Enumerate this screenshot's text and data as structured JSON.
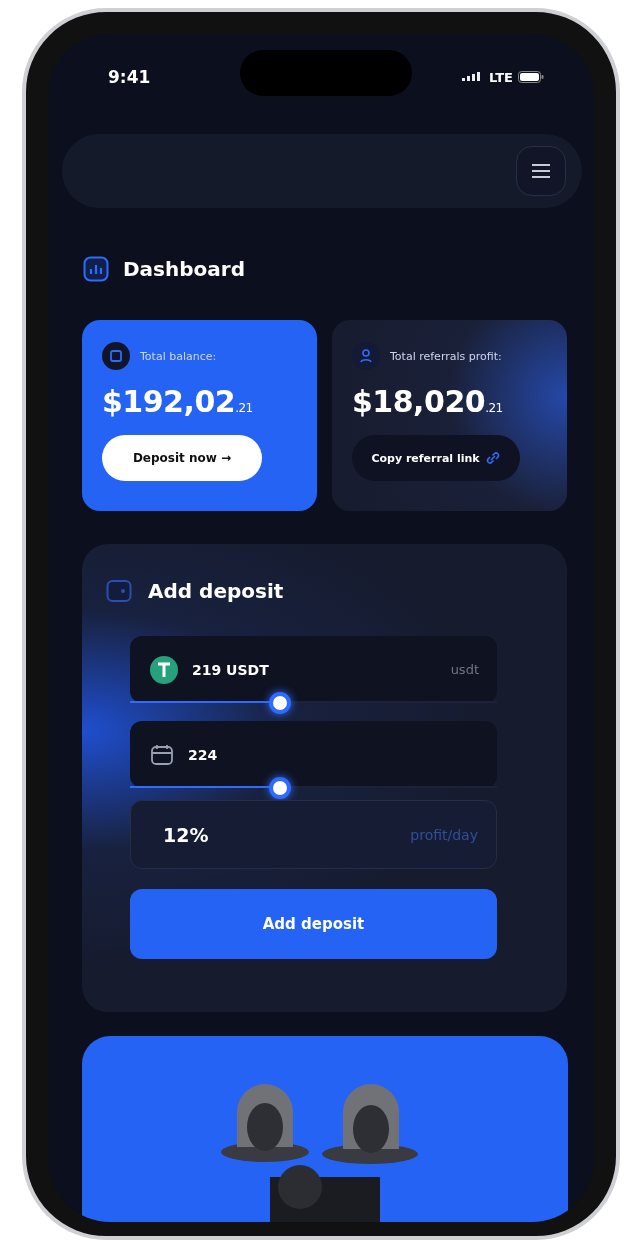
{
  "status_bar": {
    "time": "9:41",
    "network": "LTE"
  },
  "dashboard": {
    "title": "Dashboard"
  },
  "cards": [
    {
      "kind": "balance",
      "label": "Total balance:",
      "amount": "$192,02$_{.21}$",
      "button": "Deposit now →"
    },
    {
      "kind": "referral",
      "label": "Total referrals profit:",
      "amount": "$18,020$_{.21}$",
      "button": "Copy referral link"
    }
  ],
  "add_deposit": {
    "title": "Add deposit",
    "fields": [
      {
        "kind": "amount",
        "value": "219 USDT",
        "unit": "usdt",
        "level": 0.41
      },
      {
        "kind": "days",
        "value": "224",
        "level": 0.41
      },
      {
        "kind": "profit",
        "value": "12%",
        "unit": "profit/day"
      }
    ],
    "button": "Add deposit"
  }
}
